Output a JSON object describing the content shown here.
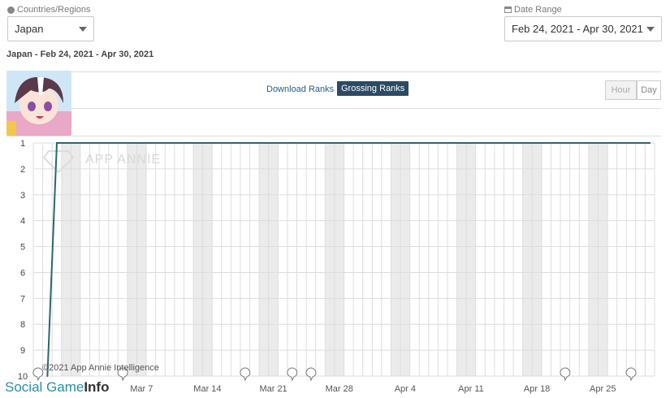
{
  "filters": {
    "country_label": "Countries/Regions",
    "country_value": "Japan",
    "date_label": "Date Range",
    "date_value": "Feb 24, 2021 - Apr 30, 2021"
  },
  "subtitle": "Japan - Feb 24, 2021 - Apr 30, 2021",
  "rank_tabs": {
    "download": "Download Ranks",
    "grossing": "Grossing Ranks"
  },
  "granularity": {
    "hour": "Hour",
    "day": "Day"
  },
  "watermark": "APP ANNIE",
  "copyright": "©2021 App Annie Intelligence",
  "footer_logo": {
    "part1": "Social Game",
    "part2": "Info"
  },
  "colors": {
    "line": "#2a6670",
    "weekend_band": "#ebebeb",
    "grid": "#dddddd",
    "active_tab": "#2c4a63"
  },
  "chart_data": {
    "type": "line",
    "title": "",
    "xlabel": "",
    "ylabel": "",
    "x_range": [
      "2021-02-24",
      "2021-04-30"
    ],
    "x_ticks": [
      "Mar 7",
      "Mar 14",
      "Mar 21",
      "Mar 28",
      "Apr 4",
      "Apr 11",
      "Apr 18",
      "Apr 25"
    ],
    "y_ticks": [
      1,
      2,
      3,
      4,
      5,
      6,
      7,
      8,
      9,
      10
    ],
    "ylim": [
      10,
      1
    ],
    "y_inverted": true,
    "grid": true,
    "series": [
      {
        "values": [
          {
            "x": "2021-02-25",
            "y": 10
          },
          {
            "x": "2021-02-26",
            "y": 1
          },
          {
            "x": "2021-04-30",
            "y": 1
          }
        ]
      }
    ],
    "annotation_markers": [
      "2021-02-24",
      "2021-03-05",
      "2021-03-18",
      "2021-03-23",
      "2021-03-25",
      "2021-04-21",
      "2021-04-28"
    ]
  }
}
